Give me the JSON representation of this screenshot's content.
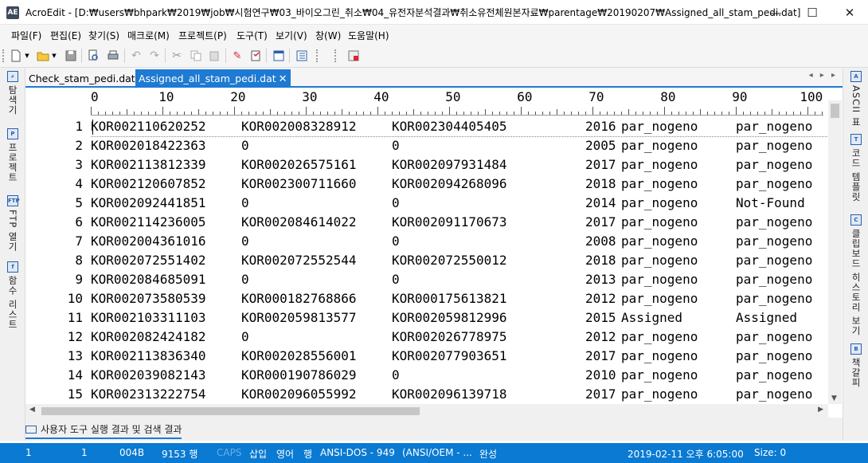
{
  "window": {
    "app_icon": "AE",
    "title": "AcroEdit - [D:₩users₩bhpark₩2019₩job₩시험연구₩03_바이오그린_취소₩04_유전자분석결과₩취소유전체원본자료₩parentage₩20190207₩Assigned_all_stam_pedi.dat]",
    "minimize": "—",
    "maximize": "☐",
    "close": "✕"
  },
  "menu": [
    "파일(F)",
    "편집(E)",
    "찾기(S)",
    "매크로(M)",
    "프로젝트(P)",
    "도구(T)",
    "보기(V)",
    "창(W)",
    "도움말(H)"
  ],
  "toolbar_icons": [
    "new-file-icon",
    "open-folder-icon",
    "save-icon",
    "print-preview-icon",
    "print-icon",
    "undo-icon",
    "redo-icon",
    "cut-icon",
    "copy-icon",
    "paste-icon",
    "marker-icon",
    "bookmark-icon",
    "window-icon",
    "list-icon",
    "calc-icon"
  ],
  "left_panel": [
    {
      "label": "탐색기",
      "icon": "explorer-icon"
    },
    {
      "label": "프로젝트",
      "icon": "project-icon"
    },
    {
      "label": "FTP 열기",
      "icon": "ftp-icon"
    },
    {
      "label": "함수 리스트",
      "icon": "function-list-icon"
    }
  ],
  "right_panel": [
    {
      "label": "ASCII 표",
      "icon": "ascii-icon"
    },
    {
      "label": "코드 템플릿",
      "icon": "code-template-icon"
    },
    {
      "label": "클립보드 히스토리 보기",
      "icon": "clipboard-icon"
    },
    {
      "label": "책갈피",
      "icon": "bookmark-panel-icon"
    }
  ],
  "tabs": [
    {
      "label": "Check_stam_pedi.dat",
      "active": false
    },
    {
      "label": "Assigned_all_stam_pedi.dat",
      "active": true
    }
  ],
  "tab_close": "✕",
  "tab_nav": "◂ ▸ ▸",
  "ruler": [
    "0",
    "10",
    "20",
    "30",
    "40",
    "50",
    "60",
    "70",
    "80",
    "90",
    "100"
  ],
  "lines": [
    {
      "n": "1",
      "c": [
        "KOR002110620252",
        "KOR002008328912",
        "KOR002304405405",
        "2016",
        "par_nogeno",
        "par_nogeno"
      ]
    },
    {
      "n": "2",
      "c": [
        "KOR002018422363",
        "0",
        "0",
        "2005",
        "par_nogeno",
        "par_nogeno"
      ]
    },
    {
      "n": "3",
      "c": [
        "KOR002113812339",
        "KOR002026575161",
        "KOR002097931484",
        "2017",
        "par_nogeno",
        "par_nogeno"
      ]
    },
    {
      "n": "4",
      "c": [
        "KOR002120607852",
        "KOR002300711660",
        "KOR002094268096",
        "2018",
        "par_nogeno",
        "par_nogeno"
      ]
    },
    {
      "n": "5",
      "c": [
        "KOR002092441851",
        "0",
        "0",
        "2014",
        "par_nogeno",
        "Not-Found"
      ]
    },
    {
      "n": "6",
      "c": [
        "KOR002114236005",
        "KOR002084614022",
        "KOR002091170673",
        "2017",
        "par_nogeno",
        "par_nogeno"
      ]
    },
    {
      "n": "7",
      "c": [
        "KOR002004361016",
        "0",
        "0",
        "2008",
        "par_nogeno",
        "par_nogeno"
      ]
    },
    {
      "n": "8",
      "c": [
        "KOR002072551402",
        "KOR002072552544",
        "KOR002072550012",
        "2018",
        "par_nogeno",
        "par_nogeno"
      ]
    },
    {
      "n": "9",
      "c": [
        "KOR002084685091",
        "0",
        "0",
        "2013",
        "par_nogeno",
        "par_nogeno"
      ]
    },
    {
      "n": "10",
      "c": [
        "KOR002073580539",
        "KOR000182768866",
        "KOR000175613821",
        "2012",
        "par_nogeno",
        "par_nogeno"
      ]
    },
    {
      "n": "11",
      "c": [
        "KOR002103311103",
        "KOR002059813577",
        "KOR002059812996",
        "2015",
        "Assigned",
        "Assigned"
      ]
    },
    {
      "n": "12",
      "c": [
        "KOR002082424182",
        "0",
        "KOR002026778975",
        "2012",
        "par_nogeno",
        "par_nogeno"
      ]
    },
    {
      "n": "13",
      "c": [
        "KOR002113836340",
        "KOR002028556001",
        "KOR002077903651",
        "2017",
        "par_nogeno",
        "par_nogeno"
      ]
    },
    {
      "n": "14",
      "c": [
        "KOR002039082143",
        "KOR000190786029",
        "0",
        "2010",
        "par_nogeno",
        "par_nogeno"
      ]
    },
    {
      "n": "15",
      "c": [
        "KOR002313222754",
        "KOR002096055992",
        "KOR002096139718",
        "2017",
        "par_nogeno",
        "par_nogeno"
      ]
    }
  ],
  "output_tab": "사용자 도구 실행 결과 및 검색 결과",
  "status": {
    "line": "1",
    "col": "1",
    "char": "004B",
    "lines_total": "9153 행",
    "caps": "CAPS",
    "insert": "삽입",
    "lang": "영어",
    "row_mode": "행",
    "encoding": "ANSI-DOS - 949",
    "oem": "(ANSI/OEM - ...",
    "complete": "완성",
    "datetime": "2019-02-11 오후 6:05:00",
    "size": "Size: 0"
  }
}
